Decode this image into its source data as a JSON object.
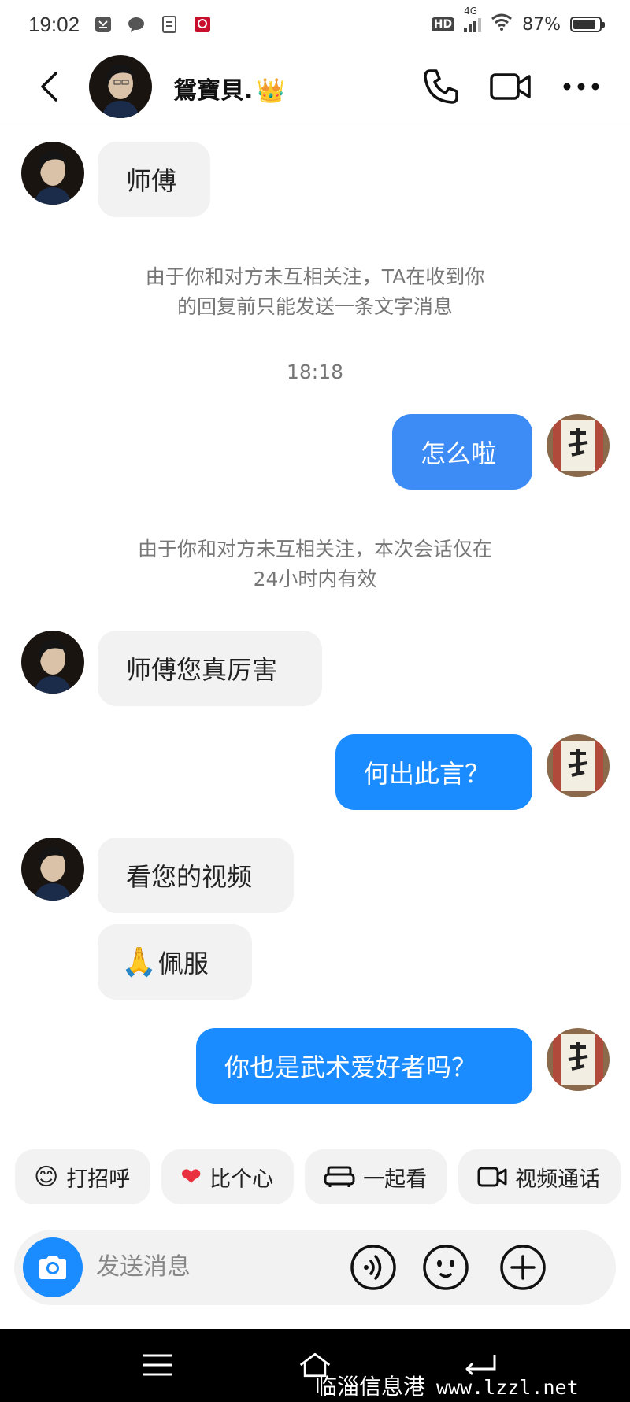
{
  "colors": {
    "bubble_out_1": "#3d8bf5",
    "bubble_out": "#1a8cff",
    "bubble_in": "#f2f2f3",
    "accent": "#1a8cff"
  },
  "status_bar": {
    "time": "19:02",
    "network": "4G",
    "hd": "HD",
    "battery": "87%",
    "battery_level": 0.87
  },
  "header": {
    "contact_name": "鴛寶貝.",
    "crown": "👑",
    "icons": [
      "back-icon",
      "phone-icon",
      "video-icon",
      "more-icon"
    ]
  },
  "messages": [
    {
      "type": "in",
      "text": "师傅"
    },
    {
      "type": "notice",
      "line1": "由于你和对方未互相关注，TA在收到你",
      "line2": "的回复前只能发送一条文字消息"
    },
    {
      "type": "time",
      "text": "18:18"
    },
    {
      "type": "out",
      "text": "怎么啦"
    },
    {
      "type": "notice",
      "line1": "由于你和对方未互相关注，本次会话仅在",
      "line2": "24小时内有效"
    },
    {
      "type": "in",
      "text": "师傅您真厉害"
    },
    {
      "type": "out",
      "text": "何出此言？"
    },
    {
      "type": "in",
      "text": "看您的视频"
    },
    {
      "type": "in",
      "emoji": "🙏",
      "text": "佩服"
    },
    {
      "type": "out",
      "text": "你也是武术爱好者吗？"
    }
  ],
  "quick_actions": [
    {
      "icon": "😊",
      "label": "打招呼"
    },
    {
      "icon": "❤",
      "label": "比个心"
    },
    {
      "icon": "sofa-icon",
      "label": "一起看"
    },
    {
      "icon": "video-icon",
      "label": "视频通话"
    }
  ],
  "composer": {
    "placeholder": "发送消息"
  },
  "watermark": {
    "text": "临淄信息港",
    "url": "www.lzzl.net"
  }
}
